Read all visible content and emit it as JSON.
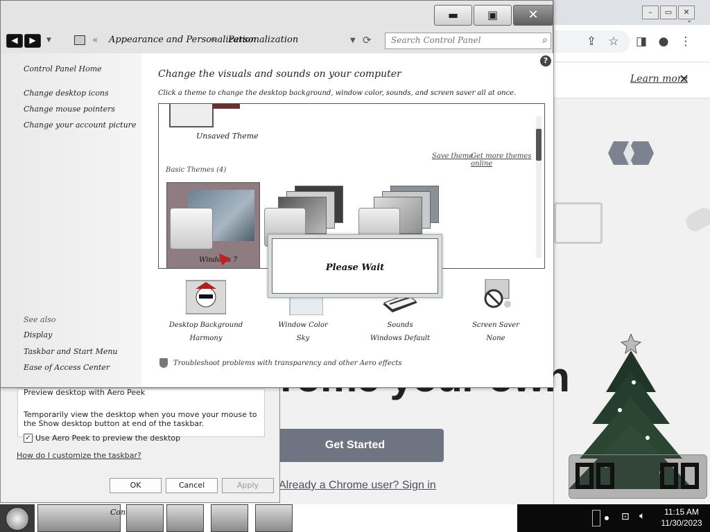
{
  "chrome": {
    "learn_more": "Learn more",
    "close_glyph": "✕",
    "heading_fragment": "rome your own",
    "get_started": "Get Started",
    "signin": "Already a Chrome user? Sign in"
  },
  "taskbar_props": {
    "group_title": "Preview desktop with Aero Peek",
    "group_desc": "Temporarily view the desktop when you move your mouse to the Show desktop button at end of the taskbar.",
    "checkbox_label": "Use Aero Peek to preview the desktop",
    "checkbox_checked": true,
    "customize_link": "How do I customize the taskbar?",
    "ok": "OK",
    "cancel": "Cancel",
    "apply": "Apply"
  },
  "control_panel": {
    "breadcrumb": [
      "Appearance and Personalization",
      "Personalization"
    ],
    "search_placeholder": "Search Control Panel",
    "left_links": [
      "Control Panel Home",
      "Change desktop icons",
      "Change mouse pointers",
      "Change your account picture"
    ],
    "see_also_header": "See also",
    "see_also": [
      "Display",
      "Taskbar and Start Menu",
      "Ease of Access Center"
    ],
    "heading": "Change the visuals and sounds on your computer",
    "subheading": "Click a theme to change the desktop background, window color, sounds, and screen saver all at once.",
    "unsaved_theme": "Unsaved Theme",
    "save_theme": "Save theme",
    "more_themes": "Get more themes online",
    "basic_header": "Basic Themes (4)",
    "selected_theme_label": "Windows 7",
    "tiles": [
      {
        "name": "Desktop Background",
        "value": "Harmony",
        "icon": "desktop-background-icon"
      },
      {
        "name": "Window Color",
        "value": "Sky",
        "icon": "window-color-icon"
      },
      {
        "name": "Sounds",
        "value": "Windows Default",
        "icon": "sounds-icon"
      },
      {
        "name": "Screen Saver",
        "value": "None",
        "icon": "screen-saver-icon"
      }
    ],
    "troubleshoot": "Troubleshoot problems with transparency and other Aero effects"
  },
  "wait_dialog": {
    "text": "Please Wait"
  },
  "taskbar": {
    "cp_label": "Contro",
    "time": "11:15 AM",
    "date": "11/30/2023"
  }
}
